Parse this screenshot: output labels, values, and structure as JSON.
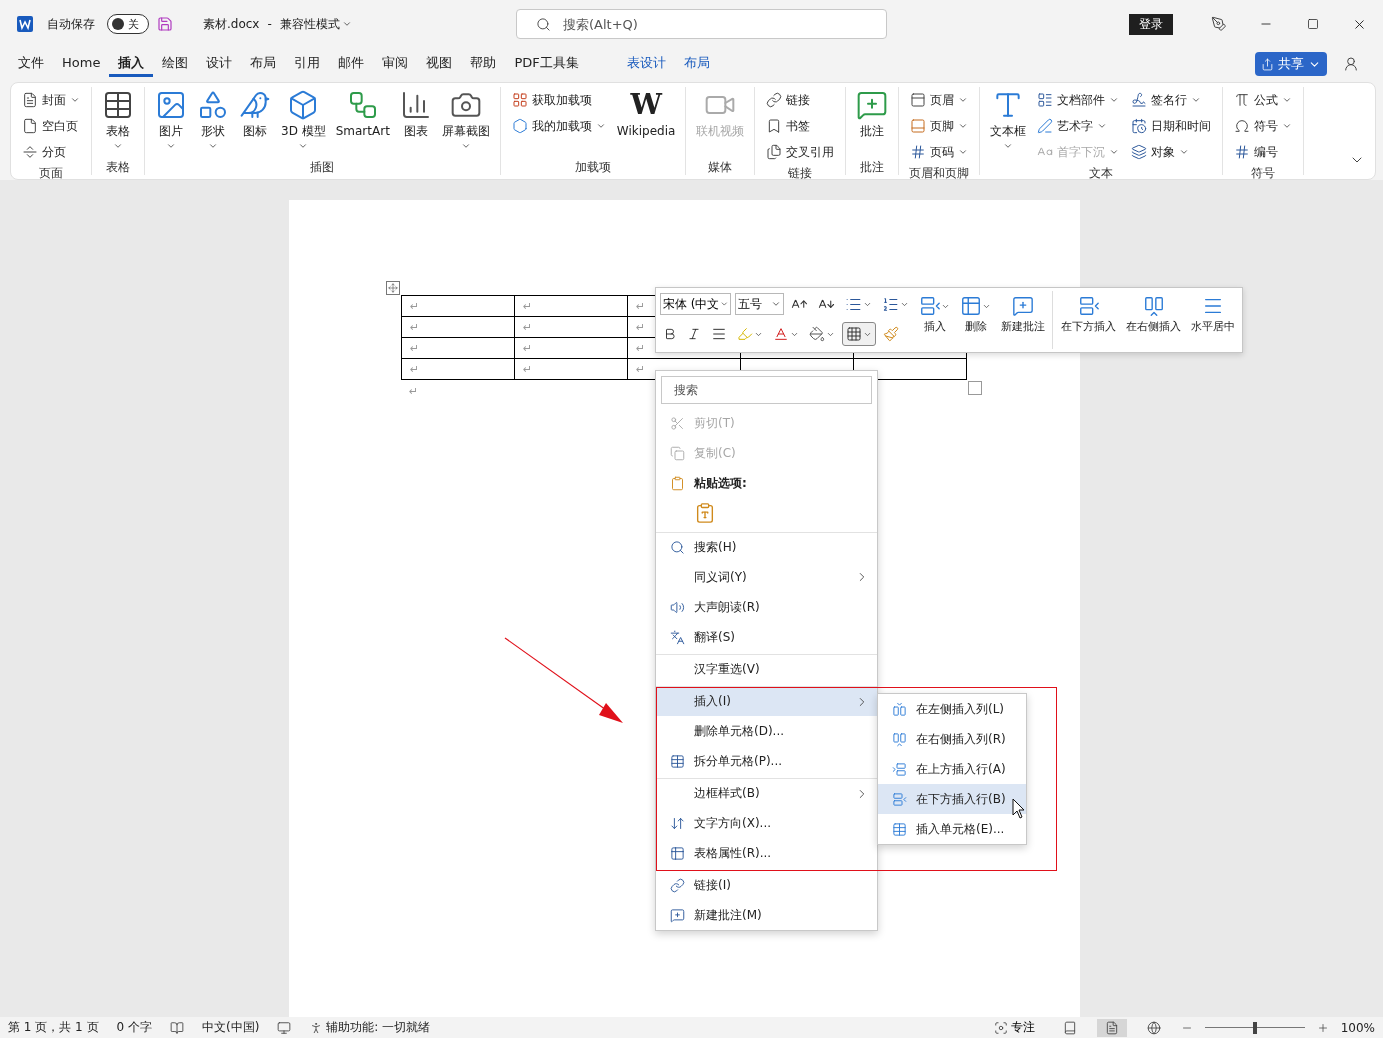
{
  "title_bar": {
    "autosave_label": "自动保存",
    "autosave": {
      "on": false,
      "label": "关"
    },
    "filename": "素材.docx",
    "separator": "-",
    "mode": "兼容性模式",
    "search": {
      "placeholder": "搜索(Alt+Q)"
    },
    "sign_in": "登录"
  },
  "tabs": [
    {
      "label": "文件",
      "selected": false,
      "kind": "normal"
    },
    {
      "label": "Home",
      "selected": false,
      "kind": "normal"
    },
    {
      "label": "插入",
      "selected": true,
      "kind": "normal"
    },
    {
      "label": "绘图",
      "selected": false,
      "kind": "normal"
    },
    {
      "label": "设计",
      "selected": false,
      "kind": "normal"
    },
    {
      "label": "布局",
      "selected": false,
      "kind": "normal"
    },
    {
      "label": "引用",
      "selected": false,
      "kind": "normal"
    },
    {
      "label": "邮件",
      "selected": false,
      "kind": "normal"
    },
    {
      "label": "审阅",
      "selected": false,
      "kind": "normal"
    },
    {
      "label": "视图",
      "selected": false,
      "kind": "normal"
    },
    {
      "label": "帮助",
      "selected": false,
      "kind": "normal"
    },
    {
      "label": "PDF工具集",
      "selected": false,
      "kind": "normal"
    },
    {
      "label": "表设计",
      "selected": false,
      "kind": "contextual"
    },
    {
      "label": "布局",
      "selected": false,
      "kind": "contextual"
    }
  ],
  "share": {
    "label": "共享"
  },
  "ribbon": {
    "groups": [
      {
        "label": "页面",
        "columns": [
          {
            "kind": "small",
            "items": [
              {
                "label": "封面",
                "dropdown": true,
                "disabled": false
              },
              {
                "label": "空白页",
                "dropdown": false,
                "disabled": false
              },
              {
                "label": "分页",
                "dropdown": false,
                "disabled": false
              }
            ]
          }
        ]
      },
      {
        "label": "表格",
        "columns": [
          {
            "kind": "large",
            "items": [
              {
                "label": "表格",
                "dropdown": true,
                "disabled": false
              }
            ]
          }
        ]
      },
      {
        "label": "插图",
        "columns": [
          {
            "kind": "large",
            "items": [
              {
                "label": "图片",
                "dropdown": true,
                "disabled": false
              },
              {
                "label": "形状",
                "dropdown": true,
                "disabled": false
              },
              {
                "label": "图标",
                "dropdown": false,
                "disabled": false
              },
              {
                "label": "3D 模型",
                "dropdown": true,
                "disabled": false
              },
              {
                "label": "SmartArt",
                "dropdown": false,
                "disabled": false
              },
              {
                "label": "图表",
                "dropdown": false,
                "disabled": false
              },
              {
                "label": "屏幕截图",
                "dropdown": true,
                "disabled": false
              }
            ]
          }
        ]
      },
      {
        "label": "加载项",
        "columns": [
          {
            "kind": "small",
            "items": [
              {
                "label": "获取加载项",
                "dropdown": false,
                "disabled": false
              },
              {
                "label": "我的加载项",
                "dropdown": true,
                "disabled": false
              }
            ]
          },
          {
            "kind": "large",
            "items": [
              {
                "label": "Wikipedia",
                "glyph": "W",
                "dropdown": false,
                "disabled": false
              }
            ]
          }
        ]
      },
      {
        "label": "媒体",
        "columns": [
          {
            "kind": "large",
            "items": [
              {
                "label": "联机视频",
                "dropdown": false,
                "disabled": true
              }
            ]
          }
        ]
      },
      {
        "label": "链接",
        "columns": [
          {
            "kind": "small",
            "items": [
              {
                "label": "链接",
                "dropdown": false,
                "disabled": false
              },
              {
                "label": "书签",
                "dropdown": false,
                "disabled": false
              },
              {
                "label": "交叉引用",
                "dropdown": false,
                "disabled": false
              }
            ]
          }
        ]
      },
      {
        "label": "批注",
        "columns": [
          {
            "kind": "large",
            "items": [
              {
                "label": "批注",
                "dropdown": false,
                "disabled": false
              }
            ]
          }
        ]
      },
      {
        "label": "页眉和页脚",
        "columns": [
          {
            "kind": "small",
            "items": [
              {
                "label": "页眉",
                "dropdown": true,
                "disabled": false
              },
              {
                "label": "页脚",
                "dropdown": true,
                "disabled": false
              },
              {
                "label": "页码",
                "dropdown": true,
                "disabled": false
              }
            ]
          }
        ]
      },
      {
        "label": "文本",
        "columns": [
          {
            "kind": "large",
            "items": [
              {
                "label": "文本框",
                "dropdown": true,
                "disabled": false
              }
            ]
          },
          {
            "kind": "small",
            "items": [
              {
                "label": "文档部件",
                "dropdown": true,
                "disabled": false
              },
              {
                "label": "艺术字",
                "dropdown": true,
                "disabled": false
              },
              {
                "label": "首字下沉",
                "dropdown": true,
                "disabled": true
              }
            ]
          },
          {
            "kind": "small",
            "items": [
              {
                "label": "签名行",
                "dropdown": true,
                "disabled": false
              },
              {
                "label": "日期和时间",
                "dropdown": false,
                "disabled": false
              },
              {
                "label": "对象",
                "dropdown": true,
                "disabled": false
              }
            ]
          }
        ]
      },
      {
        "label": "符号",
        "columns": [
          {
            "kind": "small",
            "items": [
              {
                "label": "公式",
                "dropdown": true,
                "disabled": false
              },
              {
                "label": "符号",
                "dropdown": true,
                "disabled": false
              },
              {
                "label": "编号",
                "dropdown": false,
                "disabled": false
              }
            ]
          }
        ]
      }
    ]
  },
  "document": {
    "table": {
      "rows": [
        [
          "↵",
          "↵",
          "↵"
        ],
        [
          "↵",
          "↵",
          "↵"
        ],
        [
          "↵",
          "↵",
          "↵"
        ],
        [
          "↵",
          "↵",
          "↵"
        ]
      ]
    },
    "after_table": "↵"
  },
  "mini_toolbar": {
    "font": "宋体 (中文",
    "size": "五号",
    "actions": [
      {
        "label": "插入",
        "dropdown": true,
        "divider_before": false
      },
      {
        "label": "删除",
        "dropdown": true,
        "divider_before": false
      },
      {
        "label": "新建批注",
        "dropdown": false,
        "divider_before": false
      },
      {
        "label": "在下方插入",
        "dropdown": false,
        "divider_before": true
      },
      {
        "label": "在右侧插入",
        "dropdown": false,
        "divider_before": false
      },
      {
        "label": "水平居中",
        "dropdown": false,
        "divider_before": false
      }
    ]
  },
  "context_menu": {
    "search": {
      "placeholder": "搜索"
    },
    "items": [
      {
        "kind": "item",
        "label": "剪切(T)",
        "disabled": true,
        "submenu": false,
        "highlighted": false,
        "divider_above": false
      },
      {
        "kind": "item",
        "label": "复制(C)",
        "disabled": true,
        "submenu": false,
        "highlighted": false,
        "divider_above": false
      },
      {
        "kind": "heading",
        "label": "粘贴选项:",
        "disabled": false,
        "highlighted": false,
        "divider_above": false
      },
      {
        "kind": "paste-options",
        "disabled": false,
        "highlighted": false,
        "divider_above": false
      },
      {
        "kind": "item",
        "label": "搜索(H)",
        "disabled": false,
        "submenu": false,
        "highlighted": false,
        "divider_above": true
      },
      {
        "kind": "item",
        "label": "同义词(Y)",
        "disabled": false,
        "submenu": true,
        "highlighted": false,
        "divider_above": false
      },
      {
        "kind": "item",
        "label": "大声朗读(R)",
        "disabled": false,
        "submenu": false,
        "highlighted": false,
        "divider_above": false
      },
      {
        "kind": "item",
        "label": "翻译(S)",
        "disabled": false,
        "submenu": false,
        "highlighted": false,
        "divider_above": false
      },
      {
        "kind": "item",
        "label": "汉字重选(V)",
        "disabled": false,
        "submenu": false,
        "highlighted": false,
        "divider_above": true
      },
      {
        "kind": "item",
        "label": "插入(I)",
        "disabled": false,
        "submenu": true,
        "highlighted": true,
        "divider_above": true
      },
      {
        "kind": "item",
        "label": "删除单元格(D)...",
        "disabled": false,
        "submenu": false,
        "highlighted": false,
        "divider_above": false
      },
      {
        "kind": "item",
        "label": "拆分单元格(P)...",
        "disabled": false,
        "submenu": false,
        "highlighted": false,
        "divider_above": false
      },
      {
        "kind": "item",
        "label": "边框样式(B)",
        "disabled": false,
        "submenu": true,
        "highlighted": false,
        "divider_above": true
      },
      {
        "kind": "item",
        "label": "文字方向(X)...",
        "disabled": false,
        "submenu": false,
        "highlighted": false,
        "divider_above": false
      },
      {
        "kind": "item",
        "label": "表格属性(R)...",
        "disabled": false,
        "submenu": false,
        "highlighted": false,
        "divider_above": false
      },
      {
        "kind": "item",
        "label": "链接(I)",
        "disabled": false,
        "submenu": false,
        "highlighted": false,
        "divider_above": true
      },
      {
        "kind": "item",
        "label": "新建批注(M)",
        "disabled": false,
        "submenu": false,
        "highlighted": false,
        "divider_above": false
      }
    ]
  },
  "submenu": {
    "items": [
      {
        "label": "在左侧插入列(L)",
        "selected": false
      },
      {
        "label": "在右侧插入列(R)",
        "selected": false
      },
      {
        "label": "在上方插入行(A)",
        "selected": false
      },
      {
        "label": "在下方插入行(B)",
        "selected": true
      },
      {
        "label": "插入单元格(E)...",
        "selected": false
      }
    ]
  },
  "status_bar": {
    "page": "第 1 页，共 1 页",
    "words": "0 个字",
    "language": "中文(中国)",
    "accessibility": "辅助功能: 一切就绪",
    "focus": "专注",
    "views": [
      {
        "selected": false
      },
      {
        "selected": true
      },
      {
        "selected": false
      }
    ],
    "zoom": {
      "level": 0.5,
      "reading": "100%"
    }
  }
}
